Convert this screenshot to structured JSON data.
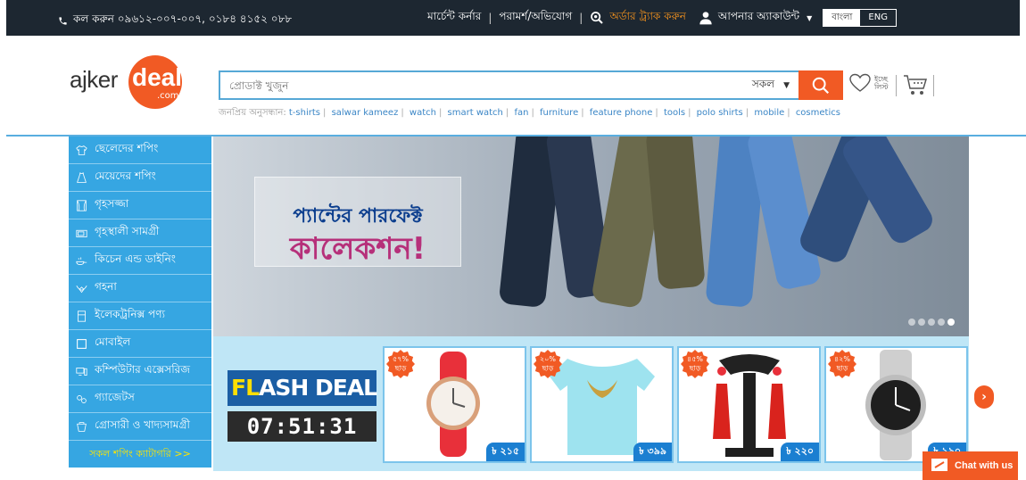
{
  "topbar": {
    "phone": "কল করুন ০৯৬১২-০০৭-০০৭, ০১৮৪ ৪১৫২ ০৮৮",
    "merchant_corner": "মার্চেন্ট কর্নার",
    "feedback": "পরামর্শ/অভিযোগ",
    "track_order": "অর্ডার ট্র্যাক করুন",
    "account": "আপনার অ্যাকাউন্ট",
    "lang_bn": "বাংলা",
    "lang_en": "ENG"
  },
  "logo": {
    "ajker": "ajker",
    "deal": "deal",
    "com": ".com"
  },
  "search": {
    "placeholder": "প্রোডাক্ট খুজুন",
    "category": "সকল",
    "popular_label": "জনপ্রিয় অনুসন্ধান:",
    "popular": [
      "t-shirts",
      "salwar kameez",
      "watch",
      "smart watch",
      "fan",
      "furniture",
      "feature phone",
      "tools",
      "polo shirts",
      "mobile",
      "cosmetics"
    ]
  },
  "wishlist": {
    "line1": "ইচ্ছে",
    "line2": "লিস্ট"
  },
  "sidebar": {
    "items": [
      {
        "label": "ছেলেদের শপিং",
        "icon": "tshirt-icon"
      },
      {
        "label": "মেয়েদের শপিং",
        "icon": "dress-icon"
      },
      {
        "label": "গৃহসজ্জা",
        "icon": "curtain-icon"
      },
      {
        "label": "গৃহস্থালী সামগ্রী",
        "icon": "appliance-icon"
      },
      {
        "label": "কিচেন এন্ড ডাইনিং",
        "icon": "kitchen-icon"
      },
      {
        "label": "গহনা",
        "icon": "jewelry-icon"
      },
      {
        "label": "ইলেকট্রনিক্স পণ্য",
        "icon": "fridge-icon"
      },
      {
        "label": "মোবাইল",
        "icon": "mobile-icon"
      },
      {
        "label": "কম্পিউটার এক্সেসরিজ",
        "icon": "computer-icon"
      },
      {
        "label": "গ্যাজেটস",
        "icon": "gadget-icon"
      },
      {
        "label": "গ্রোসারী ও খাদ্যসামগ্রী",
        "icon": "grocery-icon"
      }
    ],
    "all_categories": "সকল শপিং ক্যাটাগরি >>"
  },
  "banner": {
    "line1": "প্যান্টের পারফেক্ট",
    "line2": "কালেকশন!"
  },
  "flash": {
    "title_a": "FL",
    "title_b": "ASH DEAL",
    "timer": "07:51:31",
    "products": [
      {
        "discount": "৫৭%",
        "off": "ছাড়",
        "price": "৳ ২১৫",
        "kind": "watch-red"
      },
      {
        "discount": "২০%",
        "off": "ছাড়",
        "price": "৳ ৩৯৯",
        "kind": "tshirt"
      },
      {
        "discount": "৪৫%",
        "off": "ছাড়",
        "price": "৳ ২২০",
        "kind": "earrings"
      },
      {
        "discount": "৪২%",
        "off": "ছাড়",
        "price": "৳ ১৯০",
        "kind": "watch-silver"
      }
    ]
  },
  "chat": {
    "label": "Chat with us"
  },
  "colors": {
    "accent": "#f15a24",
    "primary": "#36a6e2",
    "topbar": "#1d2731"
  }
}
